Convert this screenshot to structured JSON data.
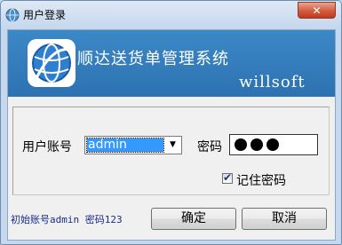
{
  "window": {
    "title": "用户登录",
    "close_label": "✕"
  },
  "banner": {
    "title": "顺达送货单管理系统",
    "subtitle": "willsoft",
    "accent": "#3c88c6"
  },
  "form": {
    "account_label": "用户账号",
    "account_value": "admin",
    "password_label": "密码",
    "password_masked_count": 3,
    "remember_label": "记住密码",
    "remember_checked": true
  },
  "hint": "初始账号admin 密码123",
  "buttons": {
    "ok": "确定",
    "cancel": "取消"
  },
  "icons": {
    "app": "globe-icon",
    "logo": "globe-logo-icon",
    "dropdown": "chevron-down-icon",
    "check": "checkmark-icon"
  }
}
